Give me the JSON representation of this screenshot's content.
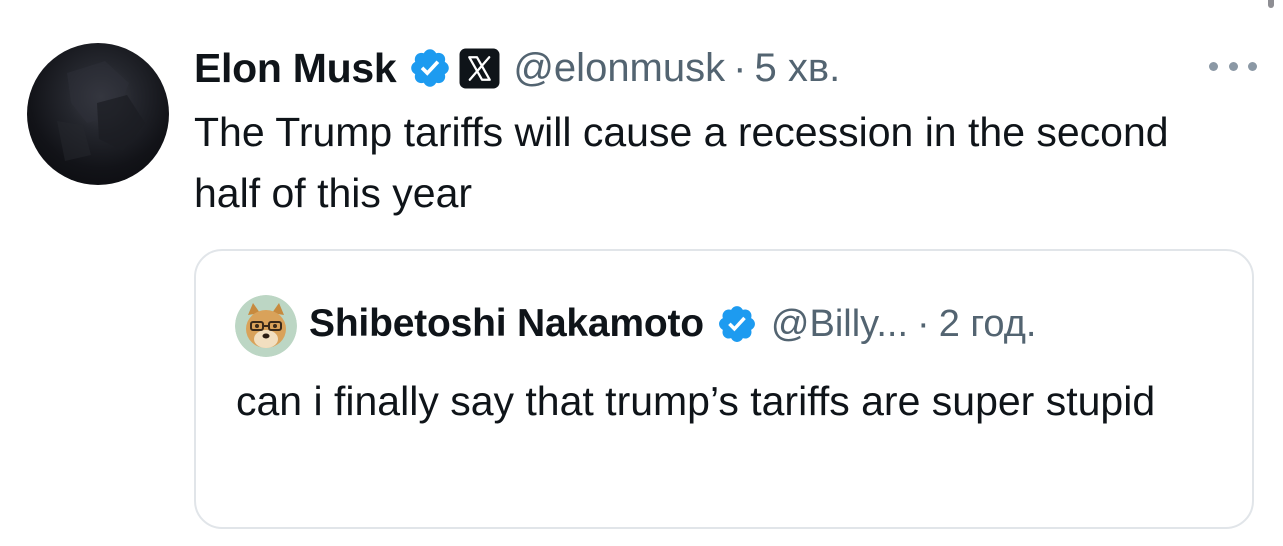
{
  "colors": {
    "text_primary": "#0f1419",
    "text_secondary": "#536471",
    "verified_blue": "#1d9bf0",
    "card_border": "#e1e5e9"
  },
  "tweet": {
    "author_name": "Elon Musk",
    "handle": "@elonmusk",
    "separator": "·",
    "time": "5 хв.",
    "text": "The Trump tariffs will cause a recession in the second half of this year",
    "icons": {
      "verified": "verified-badge-icon",
      "affiliation": "x-logo-icon",
      "more": "more-options-icon"
    }
  },
  "quoted_tweet": {
    "author_name": "Shibetoshi Nakamoto",
    "handle": "@Billy...",
    "separator": "·",
    "time": "2 год.",
    "text": "can i finally say that trump’s tariffs are super stupid",
    "icons": {
      "verified": "verified-badge-icon",
      "avatar": "doge-avatar"
    }
  }
}
